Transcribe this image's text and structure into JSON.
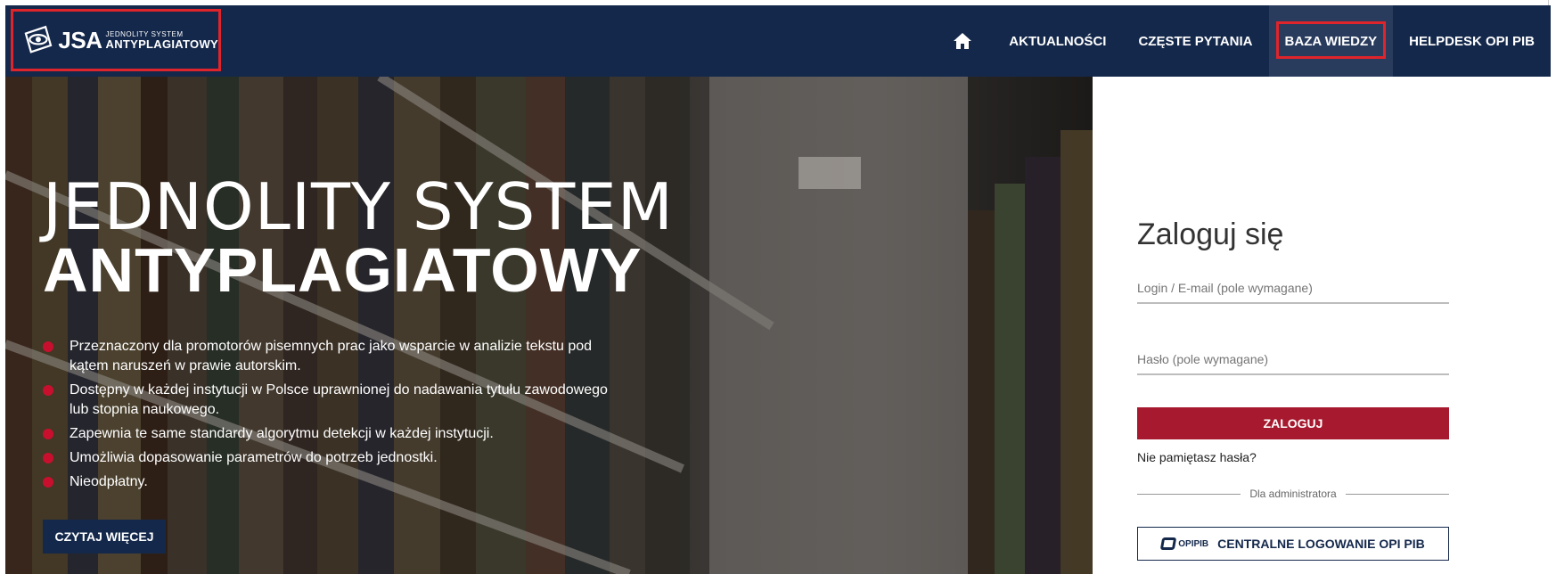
{
  "brand": {
    "logo_jsa": "JSA",
    "logo_small": "JEDNOLITY SYSTEM",
    "logo_big": "ANTYPLAGIATOWY"
  },
  "nav": {
    "items": [
      {
        "label": "AKTUALNOŚCI"
      },
      {
        "label": "CZĘSTE PYTANIA"
      },
      {
        "label": "BAZA WIEDZY"
      },
      {
        "label": "HELPDESK OPI PIB"
      }
    ]
  },
  "hero": {
    "title_line1": "JEDNOLITY SYSTEM",
    "title_line2": "ANTYPLAGIATOWY",
    "bullets": [
      "Przeznaczony dla promotorów pisemnych prac jako wsparcie w analizie tekstu pod kątem naruszeń w prawie autorskim.",
      "Dostępny w każdej instytucji w Polsce uprawnionej do nadawania tytułu zawodowego lub stopnia naukowego.",
      "Zapewnia te same standardy algorytmu detekcji w każdej instytucji.",
      "Umożliwia dopasowanie parametrów do potrzeb jednostki.",
      "Nieodpłatny."
    ],
    "read_more": "CZYTAJ WIĘCEJ"
  },
  "login": {
    "title": "Zaloguj się",
    "login_placeholder": "Login / E-mail (pole wymagane)",
    "password_placeholder": "Hasło (pole wymagane)",
    "submit": "ZALOGUJ",
    "forgot": "Nie pamiętasz hasła?",
    "admin_divider": "Dla administratora",
    "opi_logo_text": "OPIPIB",
    "opi_button": "CENTRALNE LOGOWANIE OPI PIB"
  },
  "colors": {
    "navbar": "#14284b",
    "accent_red": "#a6192e",
    "highlight": "#e0242b"
  }
}
